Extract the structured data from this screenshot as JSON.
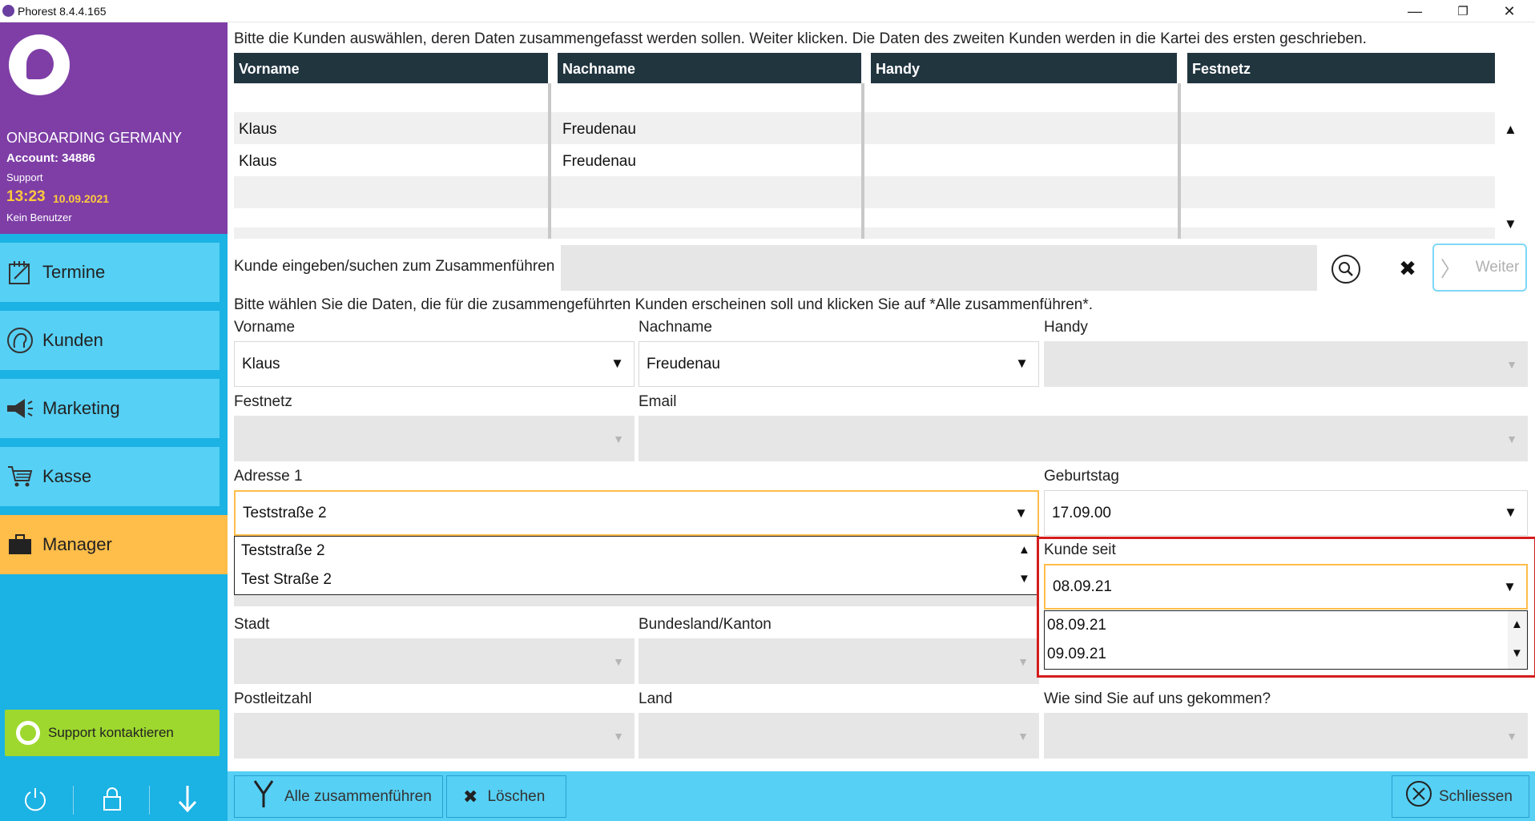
{
  "window": {
    "title": "Phorest 8.4.4.165",
    "controls": [
      "—",
      "❐",
      "✕"
    ]
  },
  "sidebar": {
    "company": "ONBOARDING GERMANY",
    "account": "Account: 34886",
    "role": "Support",
    "time": "13:23",
    "date": "10.09.2021",
    "user": "Kein Benutzer",
    "nav": [
      {
        "label": "Termine",
        "icon": "calendar-icon"
      },
      {
        "label": "Kunden",
        "icon": "client-head-icon"
      },
      {
        "label": "Marketing",
        "icon": "megaphone-icon"
      },
      {
        "label": "Kasse",
        "icon": "cart-icon"
      },
      {
        "label": "Manager",
        "icon": "briefcase-icon",
        "active": true
      }
    ],
    "support_label": "Support kontaktieren",
    "active_color": "#ffbd4a",
    "header_color": "#7e3ea6"
  },
  "main": {
    "instruction_top": "Bitte die Kunden auswählen, deren Daten zusammengefasst werden sollen. Weiter klicken. Die Daten des zweiten Kunden werden in die Kartei des ersten geschrieben.",
    "grid": {
      "columns": [
        "Vorname",
        "Nachname",
        "Handy",
        "Festnetz"
      ],
      "rows": [
        [
          "Klaus",
          "Freudenau",
          "",
          ""
        ],
        [
          "Klaus",
          "Freudenau",
          "",
          ""
        ],
        [
          "",
          "",
          "",
          ""
        ],
        [
          "",
          "",
          "",
          ""
        ]
      ]
    },
    "search_label": "Kunde eingeben/suchen zum Zusammenführen",
    "search_value": "",
    "weiter_label": "Weiter",
    "instruction_mid": "Bitte wählen Sie die Daten, die für die zusammengeführten Kunden erscheinen soll und klicken Sie auf *Alle zusammenführen*.",
    "fields": {
      "vorname": {
        "label": "Vorname",
        "value": "Klaus"
      },
      "nachname": {
        "label": "Nachname",
        "value": "Freudenau"
      },
      "handy": {
        "label": "Handy",
        "value": ""
      },
      "festnetz": {
        "label": "Festnetz",
        "value": ""
      },
      "email": {
        "label": "Email",
        "value": ""
      },
      "adresse1": {
        "label": "Adresse 1",
        "value": "Teststraße 2",
        "options": [
          "Teststraße 2",
          "Test Straße 2"
        ]
      },
      "geburtstag": {
        "label": "Geburtstag",
        "value": "17.09.00"
      },
      "kunde_seit": {
        "label": "Kunde seit",
        "value": "08.09.21",
        "options": [
          "08.09.21",
          "09.09.21"
        ]
      },
      "stadt": {
        "label": "Stadt",
        "value": ""
      },
      "bundesland": {
        "label": "Bundesland/Kanton",
        "value": ""
      },
      "postleitzahl": {
        "label": "Postleitzahl",
        "value": ""
      },
      "land": {
        "label": "Land",
        "value": ""
      },
      "quelle": {
        "label": "Wie sind Sie auf uns gekommen?",
        "value": ""
      }
    },
    "highlight_color": "#d41d1d"
  },
  "bottombar": {
    "merge_label": "Alle zusammenführen",
    "delete_label": "Löschen",
    "close_label": "Schliessen"
  }
}
